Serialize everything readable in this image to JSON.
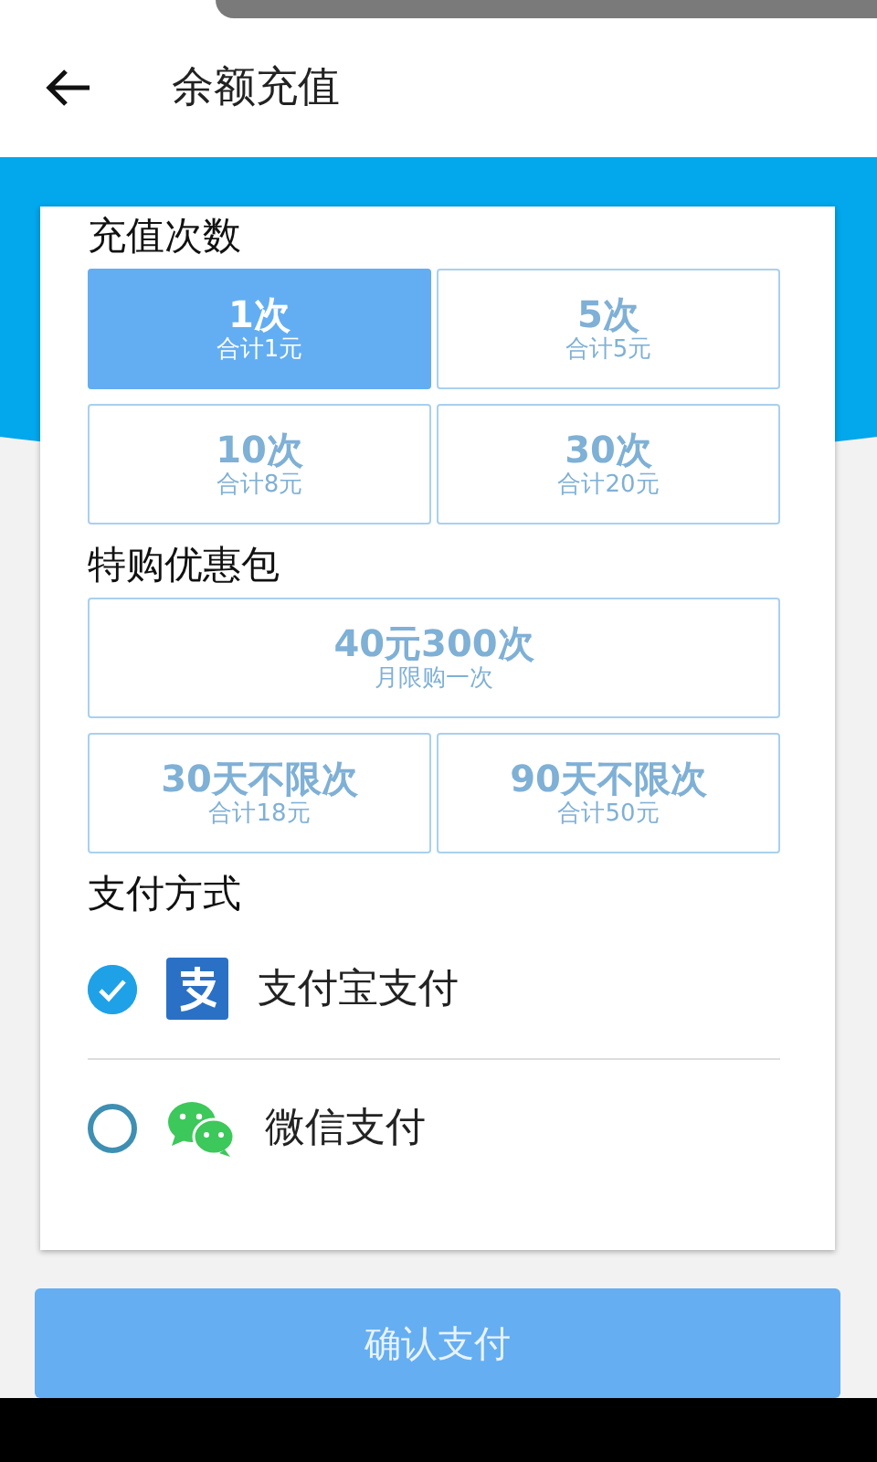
{
  "header": {
    "title": "余额充值"
  },
  "sections": [
    {
      "title": "充值次数",
      "options": [
        {
          "kind": "half",
          "label": "1次",
          "sub": "合计1元",
          "selected": true
        },
        {
          "kind": "half",
          "label": "5次",
          "sub": "合计5元",
          "selected": false
        },
        {
          "kind": "half",
          "label": "10次",
          "sub": "合计8元",
          "selected": false
        },
        {
          "kind": "half",
          "label": "30次",
          "sub": "合计20元",
          "selected": false
        }
      ]
    },
    {
      "title": "特购优惠包",
      "options": [
        {
          "kind": "wide",
          "label": "40元300次",
          "sub": "月限购一次",
          "selected": false
        },
        {
          "kind": "half",
          "label": "30天不限次",
          "sub": "合计18元",
          "selected": false
        },
        {
          "kind": "half",
          "label": "90天不限次",
          "sub": "合计50元",
          "selected": false
        }
      ]
    }
  ],
  "payment": {
    "title": "支付方式",
    "methods": [
      {
        "kind": "alipay",
        "label": "支付宝支付",
        "selected": true
      },
      {
        "kind": "wechat",
        "label": "微信支付",
        "selected": false
      }
    ]
  },
  "confirm_button": "确认支付"
}
